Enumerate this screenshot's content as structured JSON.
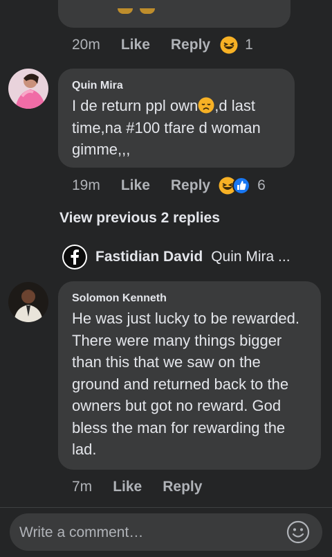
{
  "top_comment": {
    "time": "20m",
    "like": "Like",
    "reply": "Reply",
    "reaction_count": "1"
  },
  "comment1": {
    "author": "Quin Mira",
    "text_part1": "I de return ppl own",
    "text_part2": ",d last time,na #100 tfare d woman gimme,,,",
    "time": "19m",
    "like": "Like",
    "reply": "Reply",
    "reaction_count": "6"
  },
  "view_previous": "View previous 2 replies",
  "reply_preview": {
    "author": "Fastidian David",
    "text": "Quin Mira ..."
  },
  "comment2": {
    "author": "Solomon Kenneth",
    "text": "He was just lucky to be rewarded. There were many things bigger than this that we saw on the ground and returned back to the owners but got no reward. God bless the man for rewarding the lad.",
    "time": "7m",
    "like": "Like",
    "reply": "Reply"
  },
  "composer": {
    "placeholder": "Write a comment…"
  },
  "colors": {
    "background": "#242526",
    "bubble": "#3a3b3c",
    "text": "#e4e6eb",
    "muted": "#b0b3b8",
    "like_blue": "#1877f2",
    "haha_yellow": "#f7b125"
  }
}
